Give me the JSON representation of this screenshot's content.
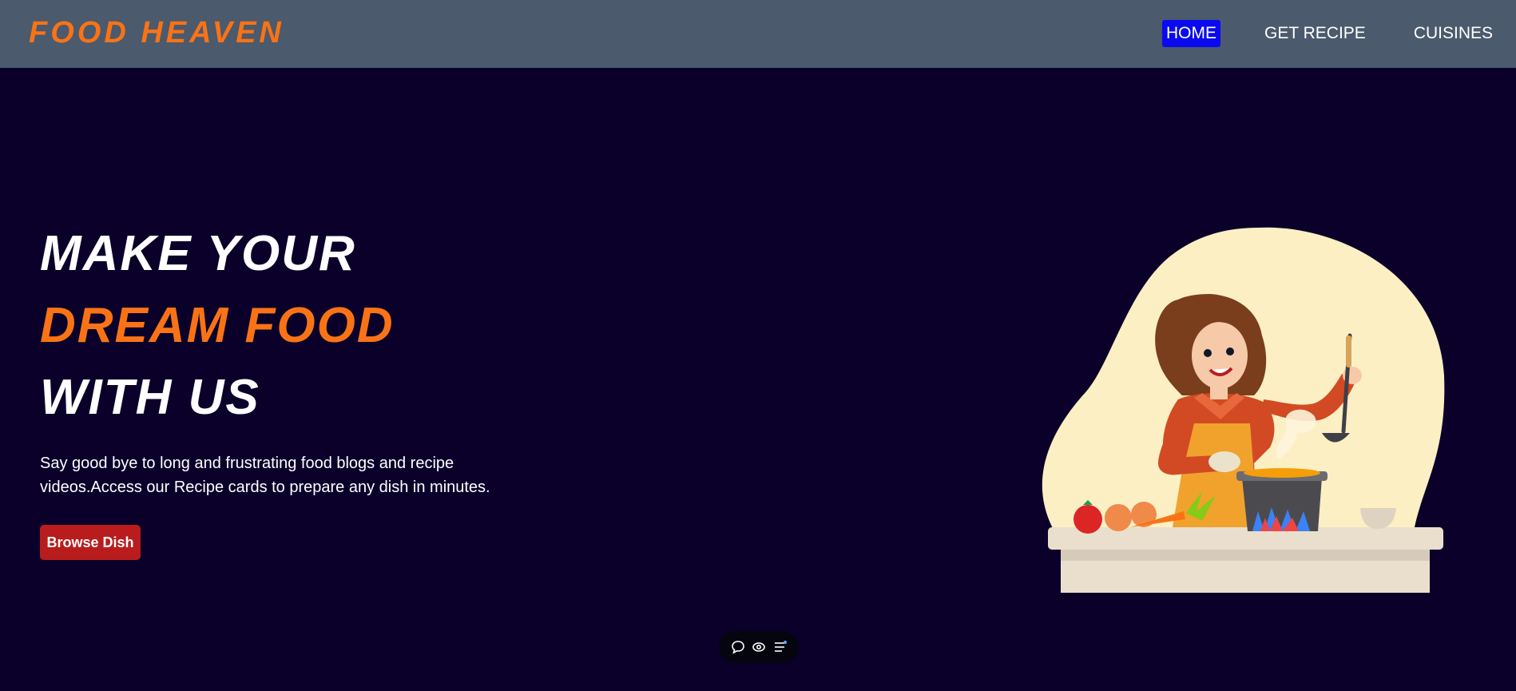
{
  "brand": {
    "name": "FOOD HEAVEN"
  },
  "nav": {
    "items": [
      {
        "label": "HOME",
        "active": true
      },
      {
        "label": "GET RECIPE",
        "active": false
      },
      {
        "label": "CUISINES",
        "active": false
      }
    ]
  },
  "hero": {
    "headline": {
      "line1": "MAKE YOUR",
      "line2": "DREAM FOOD",
      "line3": "WITH US"
    },
    "tagline": "Say good bye to long and frustrating food blogs and recipe videos.Access our Recipe cards to prepare any dish in minutes.",
    "cta_label": "Browse Dish",
    "illustration": "woman-cooking-illustration"
  },
  "floating_toolbar": {
    "icons": [
      "comment-icon",
      "eye-icon",
      "menu-list-icon"
    ]
  },
  "colors": {
    "navbar_bg": "#4b5a6c",
    "page_bg": "#0a002a",
    "accent_orange": "#f97316",
    "active_nav_bg": "#0a0af0",
    "cta_bg": "#b91c1c"
  }
}
